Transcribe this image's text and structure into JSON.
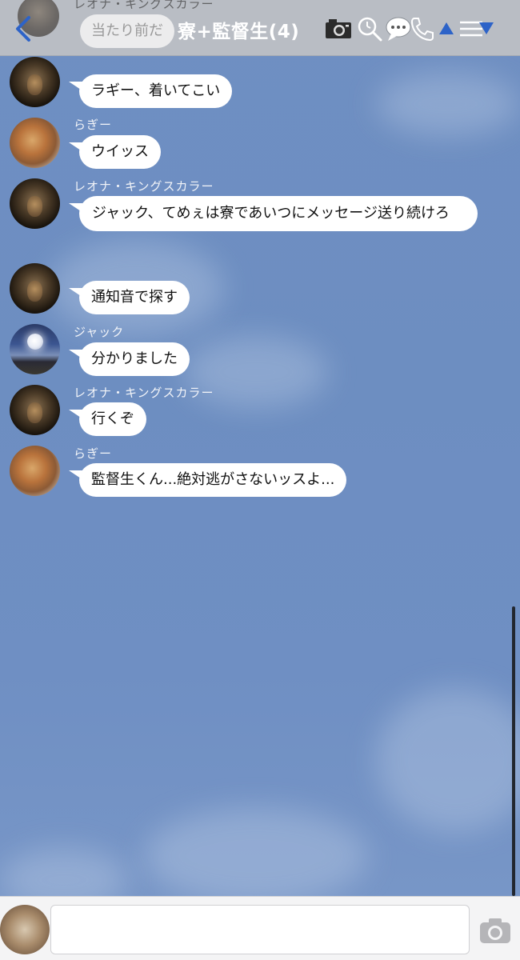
{
  "header": {
    "ghost_sender_name": "レオナ・キングスカラー",
    "ghost_bubble_text": "当たり前だ",
    "title": "寮+監督生(4)",
    "icons": [
      "back-chevron-icon",
      "camera-icon",
      "search-icon",
      "chat-bubble-icon",
      "phone-icon",
      "up-arrow-icon",
      "menu-down-icon"
    ],
    "accent_color": "#2d63c8"
  },
  "messages": [
    {
      "sender": "",
      "avatar": "lion",
      "text": "ラギー、着いてこい"
    },
    {
      "sender": "らぎー",
      "avatar": "bread",
      "text": "ウイッス"
    },
    {
      "sender": "レオナ・キングスカラー",
      "avatar": "lion",
      "text": "ジャック、てめぇは寮であいつにメッセージ送り続けろ"
    },
    {
      "sender": "",
      "avatar": "lion",
      "text": "通知音で探す"
    },
    {
      "sender": "ジャック",
      "avatar": "moon",
      "text": "分かりました"
    },
    {
      "sender": "レオナ・キングスカラー",
      "avatar": "lion",
      "text": "行くぞ"
    },
    {
      "sender": "らぎー",
      "avatar": "bread",
      "text": "監督生くん...絶対逃がさないッスよ..."
    }
  ],
  "input": {
    "value": "",
    "placeholder": "",
    "icons": [
      "camera-icon"
    ]
  }
}
